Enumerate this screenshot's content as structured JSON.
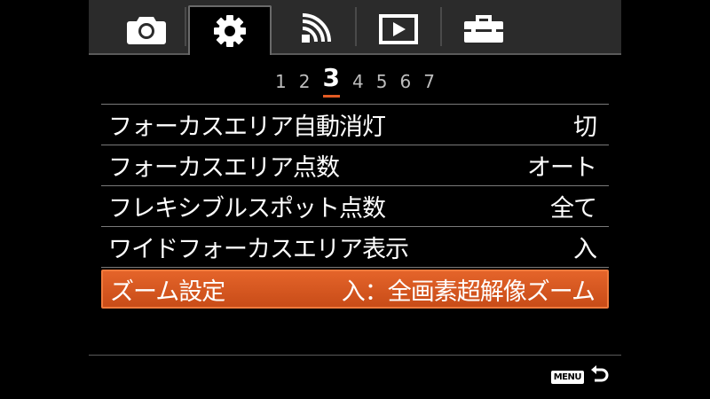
{
  "tabs": [
    {
      "name": "camera-icon",
      "active": false
    },
    {
      "name": "gear-icon",
      "active": true
    },
    {
      "name": "wireless-icon",
      "active": false
    },
    {
      "name": "playback-icon",
      "active": false
    },
    {
      "name": "toolbox-icon",
      "active": false
    }
  ],
  "pages": [
    "1",
    "2",
    "3",
    "4",
    "5",
    "6",
    "7"
  ],
  "active_page": "3",
  "menu": {
    "items": [
      {
        "label": "フォーカスエリア自動消灯",
        "value": "切"
      },
      {
        "label": "フォーカスエリア点数",
        "value": "オート"
      },
      {
        "label": "フレキシブルスポット点数",
        "value": "全て"
      },
      {
        "label": "ワイドフォーカスエリア表示",
        "value": "入"
      },
      {
        "label": "ズーム設定",
        "value": "入：全画素超解像ズーム"
      }
    ],
    "selected_index": 4
  },
  "footer": {
    "menu_badge": "MENU",
    "back_icon": "back-arrow-icon"
  },
  "colors": {
    "accent": "#e35b24",
    "selected_bg": "#d4561e",
    "tabbar_bg": "#2b2b2b"
  }
}
